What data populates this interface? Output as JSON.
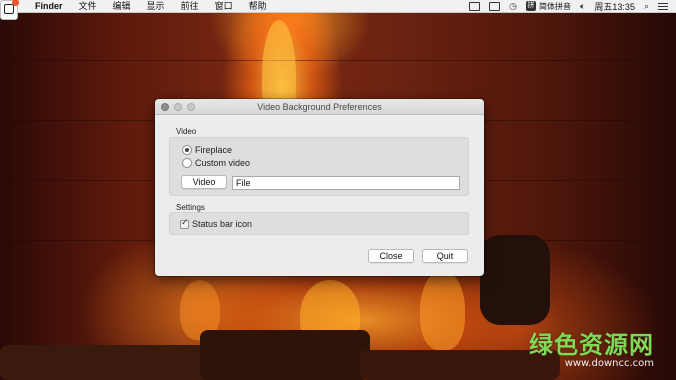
{
  "menubar": {
    "app_name": "Finder",
    "menus": [
      "文件",
      "编辑",
      "显示",
      "前往",
      "窗口",
      "帮助"
    ],
    "input_method": "简体拼音",
    "clock": "周五13:35",
    "tray_icons": [
      "airplay-icon",
      "display-icon",
      "time-machine-icon",
      "ime-icon",
      "volume-icon",
      "search-icon",
      "list-icon"
    ]
  },
  "window": {
    "title": "Video Background Preferences",
    "video_section": {
      "label": "Video",
      "options": [
        {
          "label": "Fireplace",
          "selected": true
        },
        {
          "label": "Custom video",
          "selected": false
        }
      ],
      "choose_button": "Video",
      "file_field_value": "File"
    },
    "settings_section": {
      "label": "Settings",
      "status_bar_icon": {
        "label": "Status bar icon",
        "checked": true
      }
    },
    "buttons": {
      "close": "Close",
      "quit": "Quit"
    }
  },
  "watermark": {
    "main": "绿色资源网",
    "url": "www.downcc.com"
  }
}
